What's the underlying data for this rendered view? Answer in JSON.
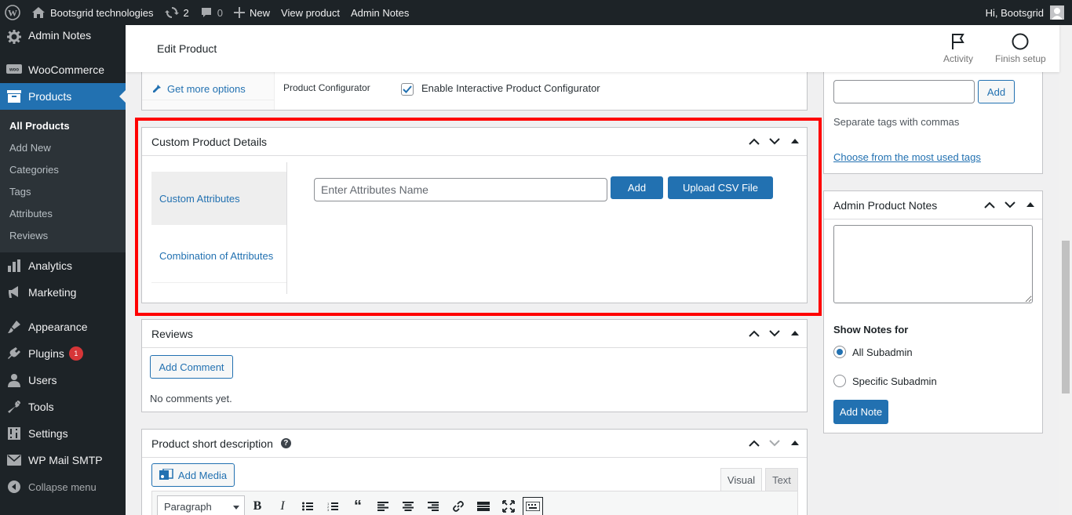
{
  "adminbar": {
    "site_name": "Bootsgrid technologies",
    "updates_count": "2",
    "comments_count": "0",
    "new_label": "New",
    "view_product": "View product",
    "admin_notes": "Admin Notes",
    "greeting": "Hi, Bootsgrid"
  },
  "sidebar": {
    "top_item": "Admin Notes",
    "woocommerce": "WooCommerce",
    "products": "Products",
    "submenu": [
      "All Products",
      "Add New",
      "Categories",
      "Tags",
      "Attributes",
      "Reviews"
    ],
    "analytics": "Analytics",
    "marketing": "Marketing",
    "appearance": "Appearance",
    "plugins": "Plugins",
    "plugins_badge": "1",
    "users": "Users",
    "tools": "Tools",
    "settings": "Settings",
    "wp_mail_smtp": "WP Mail SMTP",
    "collapse": "Collapse menu"
  },
  "header": {
    "title": "Edit Product",
    "activity": "Activity",
    "finish_setup": "Finish setup"
  },
  "product_data": {
    "get_more_options": "Get more options",
    "configurator_label": "Product Configurator",
    "configurator_checkbox": "Enable Interactive Product Configurator",
    "configurator_checked": true
  },
  "custom_details": {
    "title": "Custom Product Details",
    "tab_custom_attributes": "Custom Attributes",
    "tab_combination": "Combination of Attributes",
    "attr_placeholder": "Enter Attributes Name",
    "add_button": "Add",
    "upload_button": "Upload CSV File"
  },
  "reviews": {
    "title": "Reviews",
    "add_comment": "Add Comment",
    "no_comments": "No comments yet."
  },
  "short_description": {
    "title": "Product short description",
    "add_media": "Add Media",
    "tab_visual": "Visual",
    "tab_text": "Text",
    "format_select": "Paragraph"
  },
  "tags_box": {
    "add_button": "Add",
    "help": "Separate tags with commas",
    "most_used_link": "Choose from the most used tags"
  },
  "admin_notes_box": {
    "title": "Admin Product Notes",
    "show_notes_for": "Show Notes for",
    "option_all": "All Subadmin",
    "option_specific": "Specific Subadmin",
    "selected": "All Subadmin",
    "add_note": "Add Note"
  },
  "colors": {
    "accent": "#2271b1",
    "adminbar": "#1d2327",
    "highlight": "#ff0000"
  }
}
